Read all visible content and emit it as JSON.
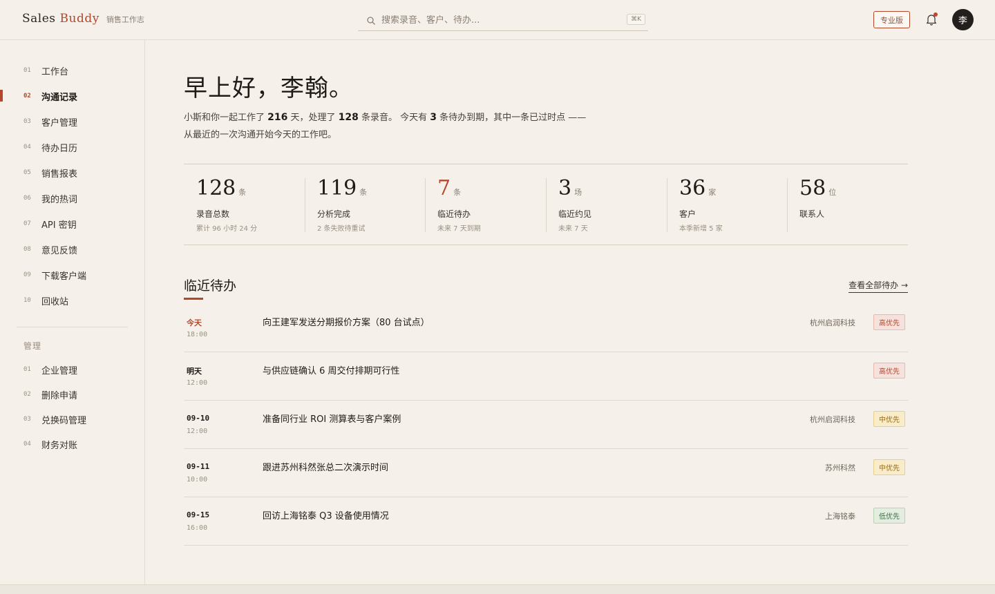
{
  "brand": {
    "name1": "Sales",
    "name2": "Buddy",
    "subtitle": "销售工作志"
  },
  "search": {
    "placeholder": "搜索录音、客户、待办...",
    "shortcut": "⌘K"
  },
  "header": {
    "pro_label": "专业版",
    "avatar_text": "李"
  },
  "sidebar": {
    "items": [
      {
        "num": "01",
        "label": "工作台"
      },
      {
        "num": "02",
        "label": "沟通记录",
        "active": true
      },
      {
        "num": "03",
        "label": "客户管理"
      },
      {
        "num": "04",
        "label": "待办日历"
      },
      {
        "num": "05",
        "label": "销售报表"
      },
      {
        "num": "06",
        "label": "我的热词"
      },
      {
        "num": "07",
        "label": "API 密钥"
      },
      {
        "num": "08",
        "label": "意见反馈"
      },
      {
        "num": "09",
        "label": "下载客户端"
      },
      {
        "num": "10",
        "label": "回收站"
      }
    ],
    "admin_title": "管理",
    "admin_items": [
      {
        "num": "01",
        "label": "企业管理"
      },
      {
        "num": "02",
        "label": "删除申请"
      },
      {
        "num": "03",
        "label": "兑换码管理"
      },
      {
        "num": "04",
        "label": "财务对账"
      }
    ]
  },
  "main": {
    "greeting": "早上好，李翰。",
    "intro": {
      "p1": "小斯和你一起工作了 ",
      "days": "216",
      "p2": " 天，处理了 ",
      "recordings": "128",
      "p3": " 条录音。 今天有 ",
      "due": "3",
      "p4": " 条待办到期，其中一条已过时点 ——",
      "line2": "从最近的一次沟通开始今天的工作吧。"
    },
    "stats": [
      {
        "value": "128",
        "unit": "条",
        "label": "录音总数",
        "sub": "累计 96 小时 24 分"
      },
      {
        "value": "119",
        "unit": "条",
        "label": "分析完成",
        "sub": "2 条失败待重试"
      },
      {
        "value": "7",
        "unit": "条",
        "label": "临近待办",
        "sub": "未来 7 天到期",
        "accent": true
      },
      {
        "value": "3",
        "unit": "场",
        "label": "临近约见",
        "sub": "未来 7 天"
      },
      {
        "value": "36",
        "unit": "家",
        "label": "客户",
        "sub": "本季新增 5 家"
      },
      {
        "value": "58",
        "unit": "位",
        "label": "联系人",
        "sub": ""
      }
    ],
    "todos_title": "临近待办",
    "todos_link": "查看全部待办 →",
    "todos": [
      {
        "day": "今天",
        "time": "18:00",
        "title": "向王建军发送分期报价方案（80 台试点）",
        "company": "杭州启润科技",
        "priority": "高优先",
        "level": "high",
        "today": true
      },
      {
        "day": "明天",
        "time": "12:00",
        "title": "与供应链确认 6 周交付排期可行性",
        "company": "",
        "priority": "高优先",
        "level": "high"
      },
      {
        "day": "09-10",
        "time": "12:00",
        "title": "准备同行业 ROI 测算表与客户案例",
        "company": "杭州启润科技",
        "priority": "中优先",
        "level": "mid"
      },
      {
        "day": "09-11",
        "time": "10:00",
        "title": "跟进苏州科然张总二次演示时间",
        "company": "苏州科然",
        "priority": "中优先",
        "level": "mid"
      },
      {
        "day": "09-15",
        "time": "16:00",
        "title": "回访上海铭泰 Q3 设备使用情况",
        "company": "上海铭泰",
        "priority": "低优先",
        "level": "low"
      }
    ]
  }
}
